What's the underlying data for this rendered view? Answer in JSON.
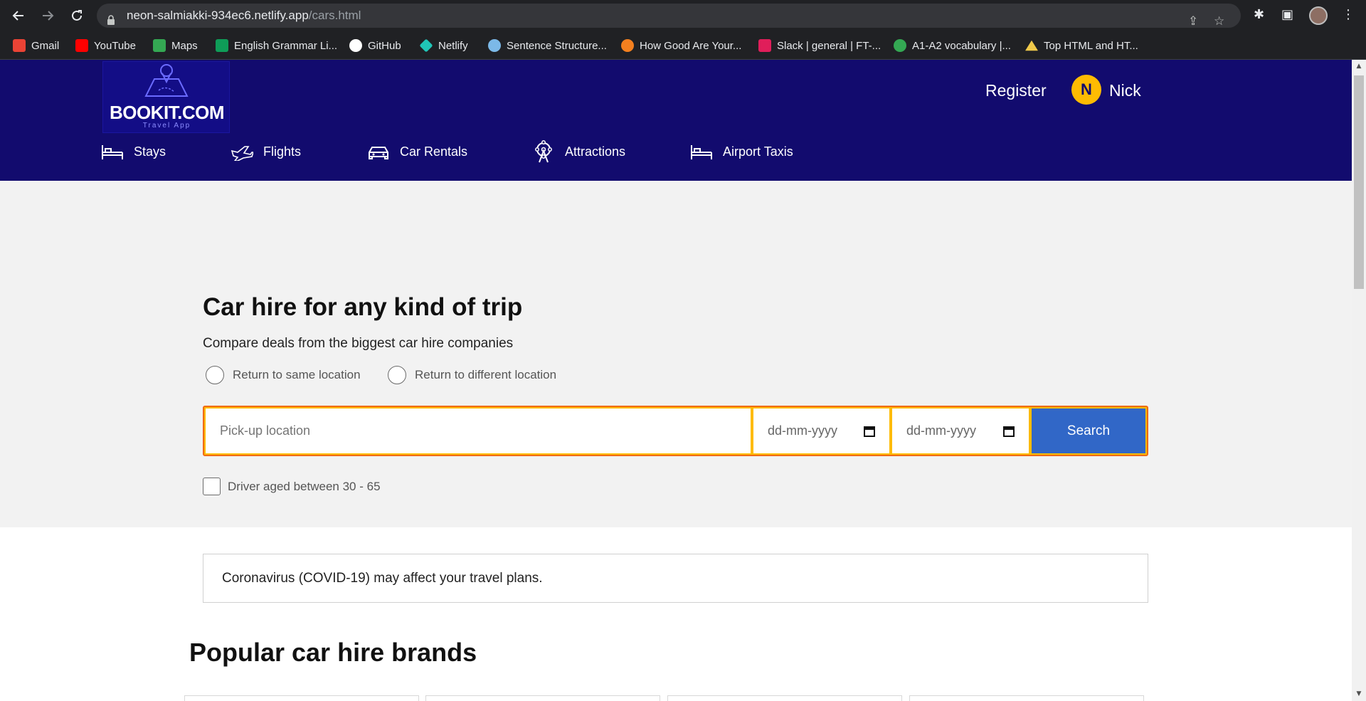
{
  "browser": {
    "url_domain": "neon-salmiakki-934ec6.netlify.app",
    "url_path": "/cars.html"
  },
  "bookmarks": [
    {
      "label": "Gmail",
      "icon": "gmail-icon",
      "color": "#ea4335"
    },
    {
      "label": "YouTube",
      "icon": "youtube-icon",
      "color": "#ff0000"
    },
    {
      "label": "Maps",
      "icon": "maps-icon",
      "color": "#34a853"
    },
    {
      "label": "English Grammar Li...",
      "icon": "sheets-icon",
      "color": "#0f9d58"
    },
    {
      "label": "GitHub",
      "icon": "github-icon",
      "color": "#ffffff"
    },
    {
      "label": "Netlify",
      "icon": "netlify-icon",
      "color": "#20c6b7"
    },
    {
      "label": "Sentence Structure...",
      "icon": "cloud-icon",
      "color": "#7cb9e8"
    },
    {
      "label": "How Good Are Your...",
      "icon": "bulb-icon",
      "color": "#f4801f"
    },
    {
      "label": "Slack | general | FT-...",
      "icon": "slack-icon",
      "color": "#e01e5a"
    },
    {
      "label": "A1-A2 vocabulary |...",
      "icon": "clover-icon",
      "color": "#34a853"
    },
    {
      "label": "Top HTML and HT...",
      "icon": "mountain-icon",
      "color": "#f0c94a"
    }
  ],
  "header": {
    "logo_text": "BOOKIT.COM",
    "logo_subtext": "Travel App",
    "register_label": "Register",
    "avatar_initial": "N",
    "user_name": "Nick",
    "nav": [
      {
        "label": "Stays",
        "icon": "bed-icon"
      },
      {
        "label": "Flights",
        "icon": "plane-icon"
      },
      {
        "label": "Car Rentals",
        "icon": "car-icon"
      },
      {
        "label": "Attractions",
        "icon": "ferris-wheel-icon"
      },
      {
        "label": "Airport Taxis",
        "icon": "bed-icon"
      }
    ]
  },
  "hero": {
    "title": "Car hire for any kind of trip",
    "subtitle": "Compare deals from the biggest car hire companies",
    "radio_same": "Return to same location",
    "radio_different": "Return to different location",
    "pickup_placeholder": "Pick-up location",
    "date_placeholder_1": "dd-mm-yyyy",
    "date_placeholder_2": "dd-mm-yyyy",
    "search_label": "Search",
    "driver_age_label": "Driver aged between 30 - 65"
  },
  "covid_notice": "Coronavirus (COVID-19) may affect your travel plans.",
  "brands_title": "Popular car hire brands",
  "colors": {
    "header_bg": "#120b6e",
    "accent_yellow": "#febb02",
    "search_button": "#3167c7",
    "hero_bg": "#f2f2f2"
  }
}
